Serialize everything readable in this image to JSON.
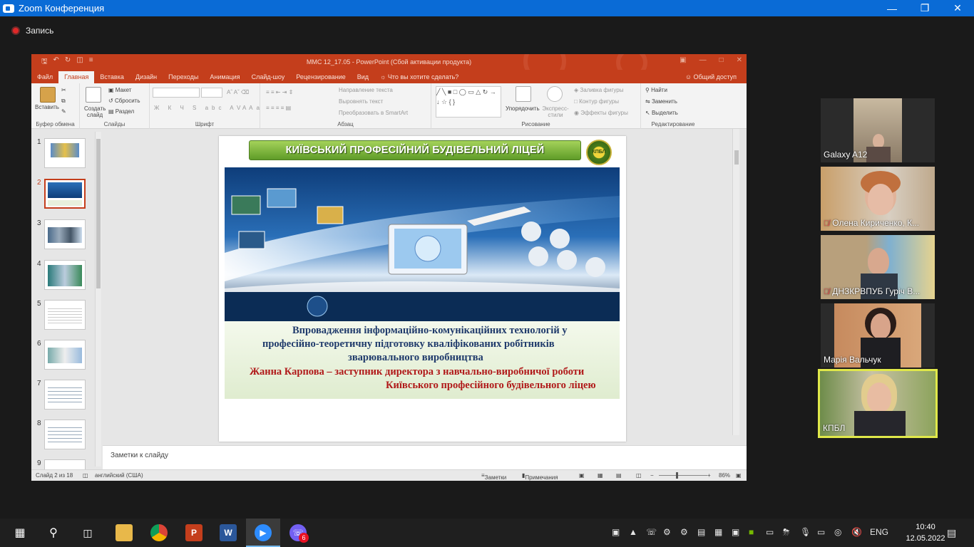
{
  "zoom": {
    "title": "Zoom Конференция",
    "record_label": "Запись"
  },
  "ppt": {
    "doc_title": "ММС 12_17.05 - PowerPoint (Сбой активации продукта)",
    "tabs": [
      "Файл",
      "Главная",
      "Вставка",
      "Дизайн",
      "Переходы",
      "Анимация",
      "Слайд-шоу",
      "Рецензирование",
      "Вид"
    ],
    "active_tab": "Главная",
    "tell_me": "Что вы хотите сделать?",
    "share": "Общий доступ",
    "ribbon": {
      "clipboard": {
        "label": "Буфер обмена",
        "paste": "Вставить"
      },
      "slides": {
        "label": "Слайды",
        "create": "Создать слайд",
        "layout": "Макет",
        "reset": "Сбросить",
        "section": "Раздел"
      },
      "font": {
        "label": "Шрифт"
      },
      "paragraph": {
        "label": "Абзац",
        "direction": "Направление текста",
        "align": "Выровнять текст",
        "smartart": "Преобразовать в SmartArt"
      },
      "drawing": {
        "label": "Рисование",
        "arrange": "Упорядочить",
        "quick_styles": "Экспресс-стили",
        "fill": "Заливка фигуры",
        "outline": "Контур фигуры",
        "effects": "Эффекты фигуры"
      },
      "editing": {
        "label": "Редактирование",
        "find": "Найти",
        "replace": "Заменить",
        "select": "Выделить"
      }
    },
    "thumbnail_numbers": [
      "1",
      "2",
      "3",
      "4",
      "5",
      "6",
      "7",
      "8",
      "9"
    ],
    "active_slide": "2",
    "slide": {
      "header": "КИЇВСЬКИЙ ПРОФЕСІЙНИЙ БУДІВЕЛЬНИЙ ЛІЦЕЙ",
      "logo_text": "КПБЛ",
      "title_line1": "Впровадження інформаційно-комунікаційних технологій у",
      "title_line2": "професійно-теоретичну підготовку кваліфікованих робітників",
      "title_line3": "зварювального виробництва",
      "author_line1": "Жанна Карпова – заступник директора з навчально-виробничої роботи",
      "author_line2": "Київського професійного будівельного ліцею"
    },
    "notes_placeholder": "Заметки к слайду",
    "status": {
      "slide_counter": "Слайд 2 из 18",
      "language": "английский (США)",
      "notes_button": "Заметки",
      "comments_button": "Примечания",
      "zoom_level": "86%"
    }
  },
  "participants": [
    {
      "name": "Galaxy A12",
      "muted": false
    },
    {
      "name": "Олена Кириченко, К...",
      "muted": true
    },
    {
      "name": "ДНЗКРВПУБ  Гуріч В...",
      "muted": true
    },
    {
      "name": "Марія Вальчук",
      "muted": false
    },
    {
      "name": "КПБЛ",
      "muted": false,
      "active": true
    }
  ],
  "taskbar": {
    "language": "ENG",
    "time": "10:40",
    "date": "12.05.2022",
    "notification_count": "6"
  },
  "colors": {
    "ppt_accent": "#c43e1c",
    "zoom_blue": "#0a6bd6",
    "active_speaker": "#e0e84a"
  }
}
